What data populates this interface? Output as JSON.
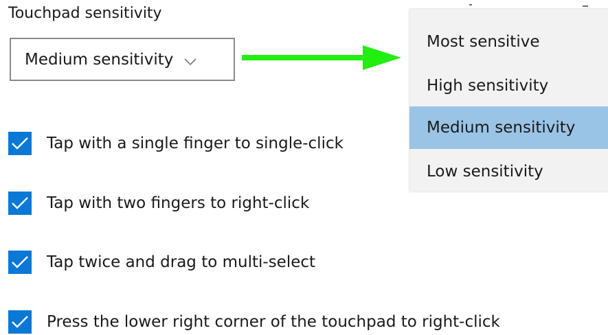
{
  "touchpad": {
    "section_label": "Touchpad sensitivity",
    "selected_value": "Medium sensitivity",
    "chevron_icon": "chevron-down-icon",
    "arrow_color": "#22ee11"
  },
  "dropdown": {
    "options": [
      {
        "label": "Most sensitive",
        "selected": false
      },
      {
        "label": "High sensitivity",
        "selected": false
      },
      {
        "label": "Medium sensitivity",
        "selected": true
      },
      {
        "label": "Low sensitivity",
        "selected": false
      }
    ],
    "highlight_color": "#99c4e6",
    "background_color": "#f2f2f2"
  },
  "checkboxes": [
    {
      "label": "Tap with a single finger to single-click",
      "checked": true
    },
    {
      "label": "Tap with two fingers to right-click",
      "checked": true
    },
    {
      "label": "Tap twice and drag to multi-select",
      "checked": true
    },
    {
      "label": "Press the lower right corner of the touchpad to right-click",
      "checked": true
    }
  ],
  "colors": {
    "checkbox_accent": "#0a78d7"
  }
}
